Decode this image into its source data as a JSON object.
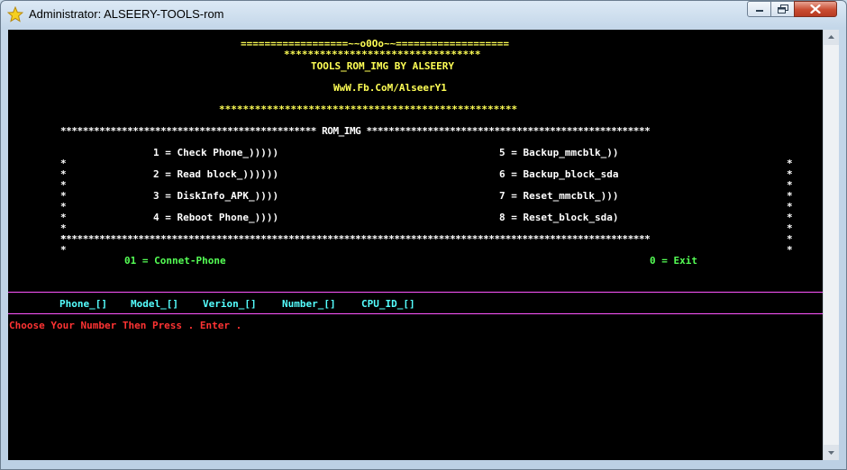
{
  "window": {
    "title": "Administrator: ALSEERY-TOOLS-rom",
    "controls": {
      "minimize_icon": "minimize-icon",
      "maximize_icon": "maximize-icon",
      "close_icon": "close-icon"
    }
  },
  "banner": {
    "top_line": "==================~~o0Oo~~===================",
    "star_line_short": "*********************************",
    "title": "TOOLS_ROM_IMG BY ALSEERY",
    "url": "WwW.Fb.CoM/AlseerY1",
    "star_line_long": "**************************************************"
  },
  "menu": {
    "header": "********************************************** ROM_IMG ***************************************************",
    "left_items": [
      "1 = Check Phone_)))))",
      "2 = Read block_))))))",
      "3 = DiskInfo_APK_))))",
      "4 = Reboot Phone_))))"
    ],
    "right_items": [
      "5 = Backup_mmcblk_))",
      "6 = Backup_block_sda",
      "7 = Reset_mmcblk_)))",
      "8 = Reset_block_sda)"
    ],
    "footer": "**********************************************************************************************************"
  },
  "options": {
    "connect": "01 = Connet-Phone",
    "exit": "0 = Exit"
  },
  "status": {
    "fields": [
      "Phone_[]",
      "Model_[]",
      "Verion_[]",
      "Number_[]",
      "CPU_ID_[]"
    ]
  },
  "prompt": "Choose Your Number Then Press . Enter ."
}
